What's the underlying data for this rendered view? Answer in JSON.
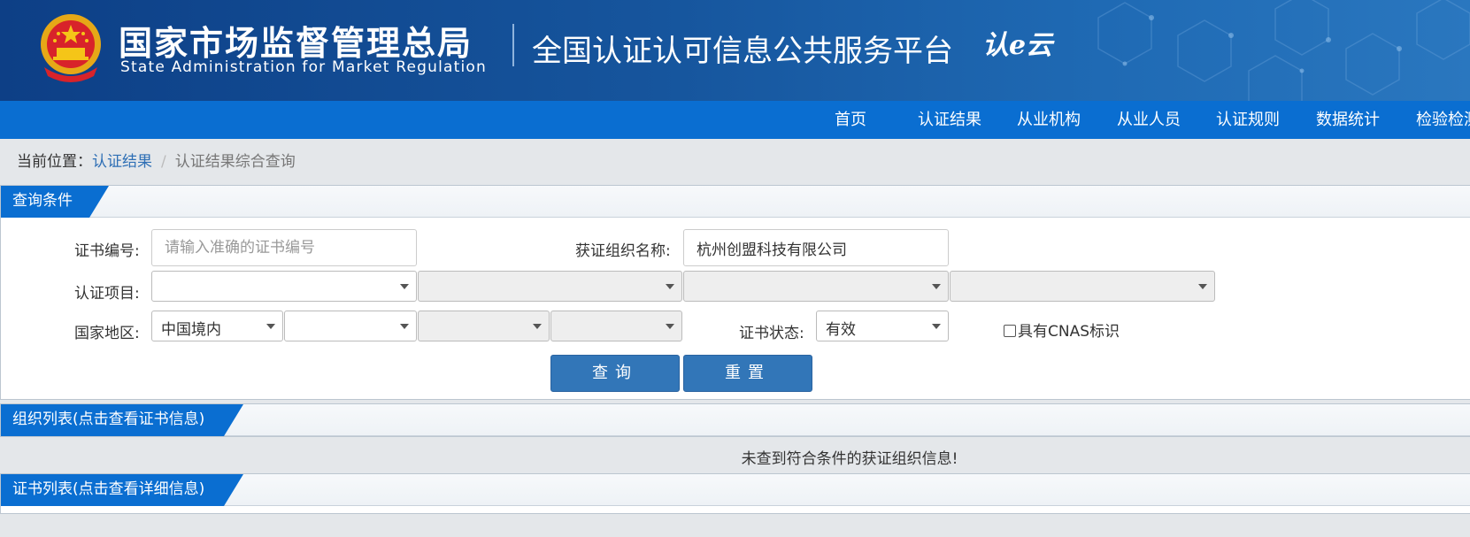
{
  "header": {
    "org_cn": "国家市场监督管理总局",
    "org_en": "State Administration  for  Market Regulation",
    "platform_title": "全国认证认可信息公共服务平台",
    "platform_logo_text": "认e云"
  },
  "nav": {
    "items": [
      "首页",
      "认证结果",
      "从业机构",
      "从业人员",
      "认证规则",
      "数据统计",
      "检验检测"
    ]
  },
  "breadcrumb": {
    "prefix": "当前位置：",
    "link": "认证结果",
    "separator": "/",
    "current": "认证结果综合查询"
  },
  "query_panel": {
    "title": "查询条件",
    "cert_no_label": "证书编号:",
    "cert_no_placeholder": "请输入准确的证书编号",
    "cert_no_value": "",
    "org_name_label": "获证组织名称:",
    "org_name_value": "杭州创盟科技有限公司",
    "cert_project_label": "认证项目:",
    "cert_project_values": [
      "",
      "",
      "",
      ""
    ],
    "region_label": "国家地区:",
    "region_values": [
      "中国境内",
      "",
      "",
      ""
    ],
    "cert_status_label": "证书状态:",
    "cert_status_value": "有效",
    "cnas_label": "具有CNAS标识",
    "cnas_checked": false,
    "query_button": "查询",
    "reset_button": "重置"
  },
  "org_list_panel": {
    "title": "组织列表(点击查看证书信息)",
    "empty_message": "未查到符合条件的获证组织信息!"
  },
  "cert_list_panel": {
    "title": "证书列表(点击查看详细信息)"
  },
  "colors": {
    "header_dark": "#0d3f86",
    "nav_blue": "#0a6ed1",
    "tab_blue": "#0a6ed1",
    "button_blue": "#3276b8",
    "link_blue": "#2e6fb5"
  }
}
